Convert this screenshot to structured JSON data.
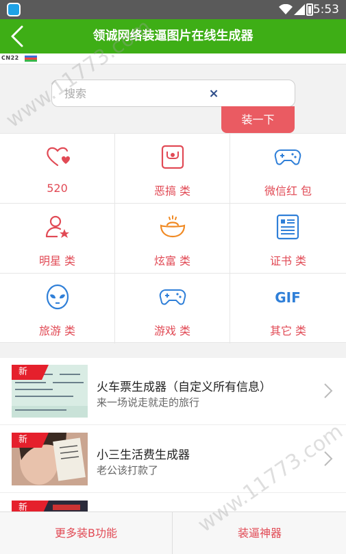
{
  "status_bar": {
    "time": "5:53"
  },
  "header": {
    "title": "领诚网络装逼图片在线生成器"
  },
  "banner": {
    "text": "CN22"
  },
  "search": {
    "placeholder": "搜索",
    "clear_glyph": "×",
    "button_label": "装一下"
  },
  "categories": [
    {
      "label": "520",
      "icon": "heart-icon"
    },
    {
      "label": "恶搞 类",
      "icon": "box-icon"
    },
    {
      "label": "微信红 包",
      "icon": "gamepad-icon"
    },
    {
      "label": "明星 类",
      "icon": "person-star-icon"
    },
    {
      "label": "炫富 类",
      "icon": "gold-ingot-icon"
    },
    {
      "label": "证书 类",
      "icon": "certificate-icon"
    },
    {
      "label": "旅游 类",
      "icon": "alien-icon"
    },
    {
      "label": "游戏 类",
      "icon": "gamepad-icon"
    },
    {
      "label": "其它 类",
      "icon": "gif-icon"
    }
  ],
  "list": [
    {
      "badge": "新",
      "title": "火车票生成器（自定义所有信息）",
      "subtitle": "来一场说走就走的旅行"
    },
    {
      "badge": "新",
      "title": "小三生活费生成器",
      "subtitle": "老公该打款了"
    },
    {
      "badge": "新",
      "title": "",
      "subtitle": ""
    }
  ],
  "bottom": {
    "left": "更多装B功能",
    "right": "装逼神器"
  },
  "watermark": "www.11773.com",
  "colors": {
    "header": "#3eae16",
    "accent": "#e14a55",
    "button": "#ea5b62"
  }
}
